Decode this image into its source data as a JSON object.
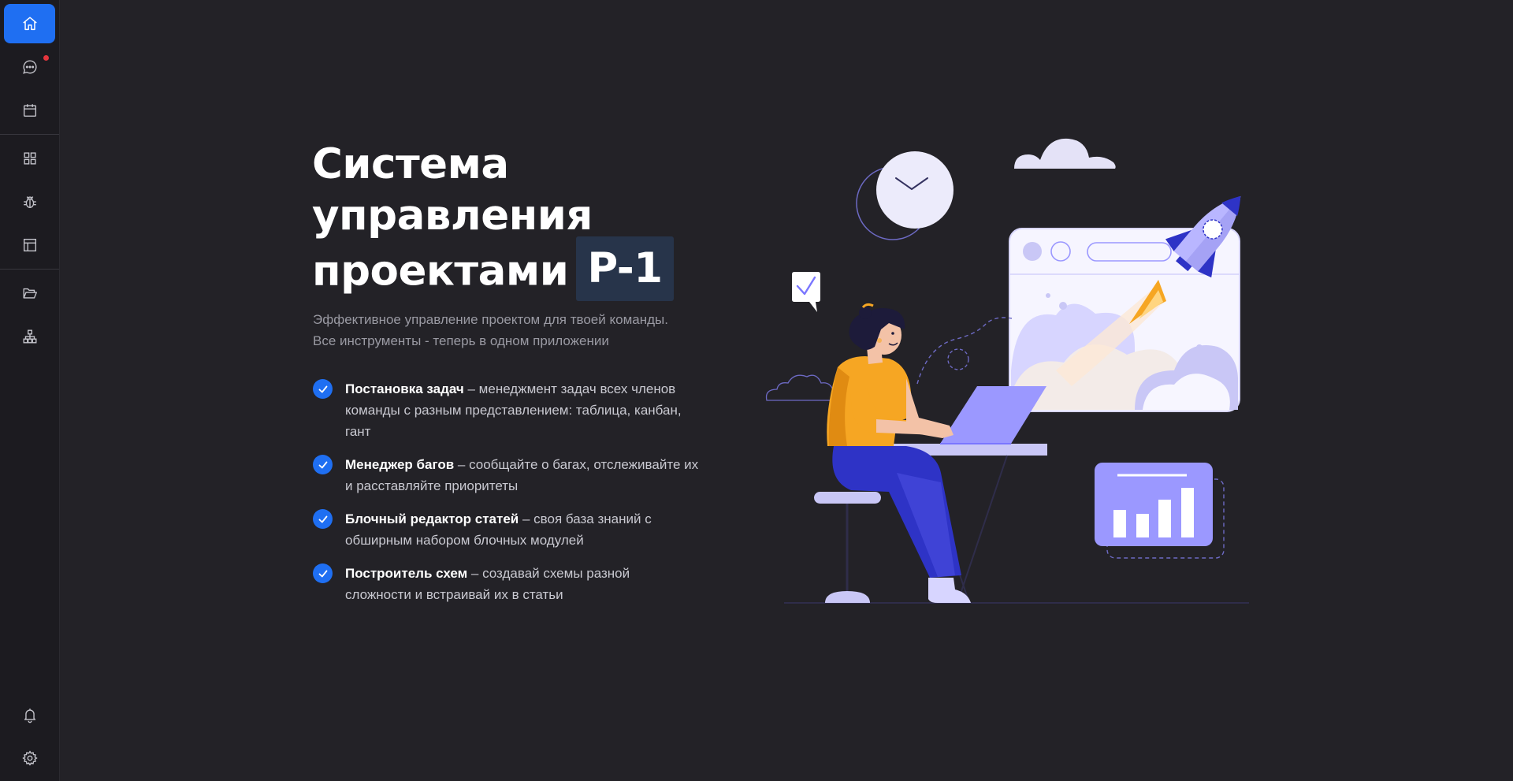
{
  "sidebar": {
    "top_items": [
      {
        "icon": "home-icon",
        "active": true
      },
      {
        "icon": "chat-icon",
        "notification": true
      },
      {
        "icon": "calendar-icon"
      }
    ],
    "middle_items": [
      {
        "icon": "grid-icon"
      },
      {
        "icon": "bug-icon"
      },
      {
        "icon": "layout-icon"
      }
    ],
    "lower_items": [
      {
        "icon": "folder-open-icon"
      },
      {
        "icon": "sitemap-icon"
      }
    ],
    "bottom_items": [
      {
        "icon": "bell-icon"
      },
      {
        "icon": "gear-icon"
      }
    ],
    "accent_color": "#1f6ff2",
    "notification_color": "#e5353d"
  },
  "hero": {
    "title_line1": "Система",
    "title_line2": "управления",
    "title_line3": "проектами",
    "brand": "P-1",
    "subtitle_line1": "Эффективное управление проектом для твоей команды.",
    "subtitle_line2": "Все инструменты - теперь в одном приложении"
  },
  "features": [
    {
      "title": "Постановка задач",
      "text": " – менеджмент задач всех членов команды с разным представлением: таблица, канбан, гант"
    },
    {
      "title": "Менеджер багов",
      "text": " – сообщайте о багах, отслеживайте их и расставляйте приоритеты"
    },
    {
      "title": "Блочный редактор статей",
      "text": " – своя база знаний с обширным набором блочных модулей"
    },
    {
      "title": "Построитель схем",
      "text": " – создавай схемы разной сложности и встраивай их в статьи"
    }
  ],
  "illustration": {
    "subject": "woman-at-laptop-with-rocket-illustration",
    "palette": [
      "#9b98ff",
      "#2e33c6",
      "#f6a623",
      "#d7d5ff",
      "#ffffff"
    ]
  }
}
